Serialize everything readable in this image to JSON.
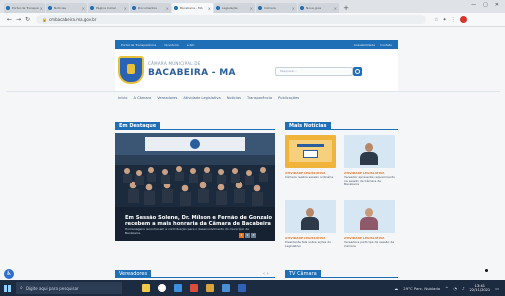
{
  "browser": {
    "tabs": [
      {
        "title": "Portal da Transparência"
      },
      {
        "title": "Notícias"
      },
      {
        "title": "Página Inicial"
      },
      {
        "title": "Documentos"
      },
      {
        "title": "Bacabeira - MA"
      },
      {
        "title": "Legislação"
      },
      {
        "title": "Câmara"
      },
      {
        "title": "Nova guia"
      }
    ],
    "active_tab_index": 4,
    "url": "cmbacabeira.ma.gov.br",
    "window_controls": [
      "—",
      "▢",
      "✕"
    ]
  },
  "site": {
    "topbar_left": [
      "Portal da Transparência",
      "Ouvidoria",
      "e-SIC"
    ],
    "topbar_right": [
      "Acessibilidade",
      "Contato"
    ],
    "brand_sup": "CÂMARA MUNICIPAL DE",
    "brand_name": "BACABEIRA - MA",
    "search_placeholder": "Pesquisar...",
    "menu": [
      "Início",
      "A Câmara",
      "Vereadores",
      "Atividade Legislativa",
      "Notícias",
      "Transparência",
      "Publicações"
    ],
    "featured_section": "Em Destaque",
    "featured_title": "Em Sessão Solene, Dr. Mílson e Fernão de Gonzalo recebem a mais honraria da Câmara de Bacabeira",
    "featured_sub": "Homenagens reconhecem a contribuição para o desenvolvimento do município de Bacabeira.",
    "featured_pages": [
      "1",
      "2",
      "3"
    ],
    "news_section": "Mais Notícias",
    "news": [
      {
        "category": "ATIVIDADE LEGISLATIVA",
        "title": "Câmara realiza sessão ordinária"
      },
      {
        "category": "ATIVIDADE LEGISLATIVA",
        "title": "Vereador apresenta requerimento na sessão da Câmara de Bacabeira"
      },
      {
        "category": "ATIVIDADE LEGISLATIVA",
        "title": "Presidente fala sobre ações do Legislativo"
      },
      {
        "category": "ATIVIDADE LEGISLATIVA",
        "title": "Vereadora participa de sessão da Câmara"
      }
    ],
    "bottom_left_section": "Vereadores",
    "bottom_right_section": "TV Câmara"
  },
  "taskbar": {
    "search_placeholder": "Digite aqui para pesquisar",
    "weather": "29°C Parc. Nublado",
    "time": "13:41",
    "date": "22/11/2021"
  },
  "colors": {
    "brand_blue": "#1f6fb6",
    "accent_orange": "#e3782a",
    "taskbar": "#1d2b40"
  }
}
